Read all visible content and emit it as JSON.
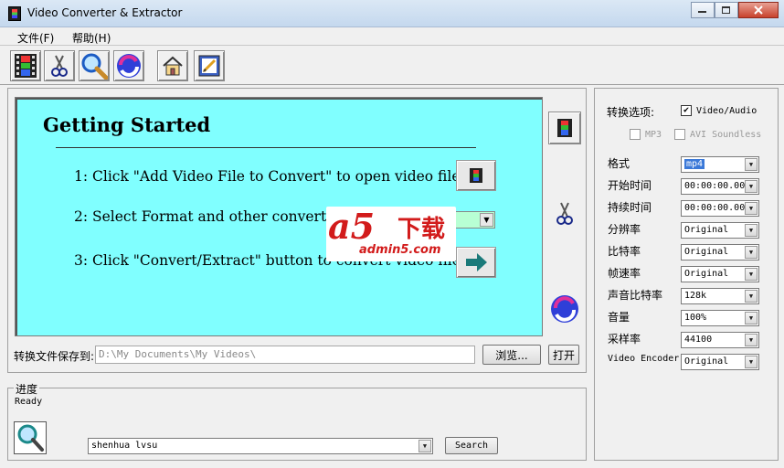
{
  "window": {
    "title": "Video Converter & Extractor"
  },
  "menu": {
    "items": [
      "文件(F)",
      "帮助(H)"
    ]
  },
  "toolbar": {
    "icons": [
      "film-icon",
      "scissors-icon",
      "magnifier-icon",
      "refresh-icon",
      "home-icon",
      "edit-icon"
    ]
  },
  "getting_started": {
    "title": "Getting Started",
    "steps": [
      "1: Click \"Add Video File to Convert\" to open video file",
      "2: Select Format and other convert op",
      "3: Click \"Convert/Extract\" button to convert video file"
    ]
  },
  "watermark": {
    "logo": "a5",
    "chars": "下载",
    "site": "admin5.com"
  },
  "save": {
    "label": "转换文件保存到:",
    "path_value": "D:\\My Documents\\My Videos\\",
    "browse_label": "浏览...",
    "open_label": "打开"
  },
  "progress": {
    "legend": "进度",
    "status": "Ready",
    "combo_value": "shenhua lvsu",
    "search_label": "Search"
  },
  "options": {
    "title": "转换选项:",
    "video_audio": {
      "label": "Video/Audio",
      "checked": true
    },
    "mp3": {
      "label": "MP3",
      "checked": false
    },
    "avi_soundless": {
      "label": "AVI Soundless",
      "checked": false
    },
    "rows": [
      {
        "label": "格式",
        "value": "mp4"
      },
      {
        "label": "开始时间",
        "value": "00:00:00.00"
      },
      {
        "label": "持续时间",
        "value": "00:00:00.00"
      },
      {
        "label": "分辨率",
        "value": "Original"
      },
      {
        "label": "比特率",
        "value": "Original"
      },
      {
        "label": "帧速率",
        "value": "Original"
      },
      {
        "label": "声音比特率",
        "value": "128k"
      },
      {
        "label": "音量",
        "value": "100%"
      },
      {
        "label": "采样率",
        "value": "44100"
      },
      {
        "label": "Video Encoder",
        "value": "Original"
      }
    ]
  }
}
